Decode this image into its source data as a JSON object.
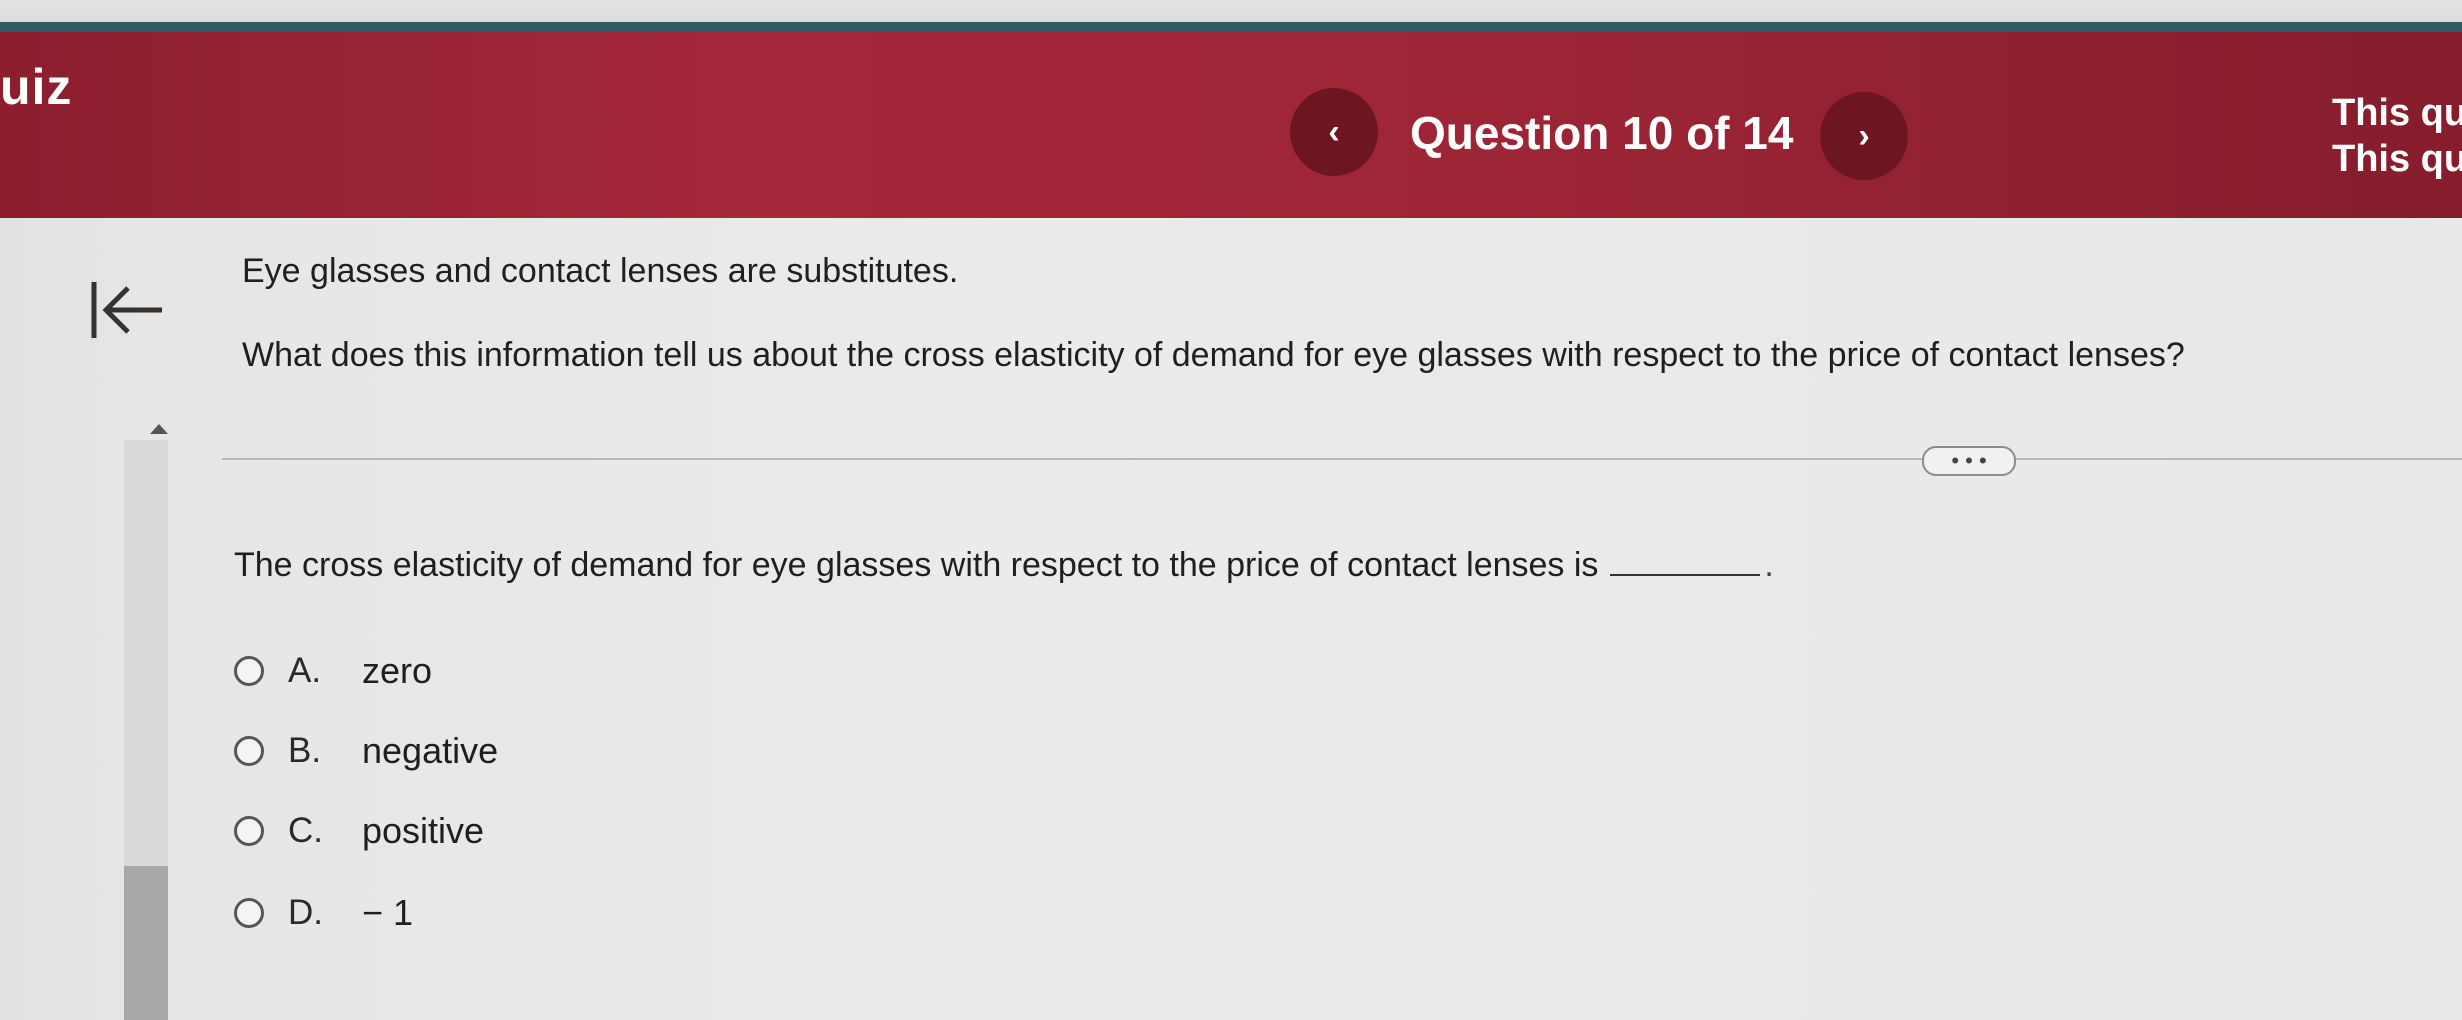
{
  "header": {
    "title": "uiz",
    "question_counter": "Question 10 of 14",
    "prev_glyph": "‹",
    "next_glyph": "›",
    "right_note_line1": "This qu",
    "right_note_line2": "This qu"
  },
  "question": {
    "line1": "Eye glasses and contact lenses are substitutes.",
    "line2": "What does this information tell us about the cross elasticity of demand for eye glasses with respect to the price of contact lenses?",
    "more_label": "• • •",
    "statement": "The cross elasticity of demand for eye glasses with respect to the price of contact lenses is",
    "statement_end": "."
  },
  "options": [
    {
      "letter": "A.",
      "text": "zero"
    },
    {
      "letter": "B.",
      "text": "negative"
    },
    {
      "letter": "C.",
      "text": "positive"
    },
    {
      "letter": "D.",
      "text": "− 1"
    }
  ],
  "colors": {
    "header_red": "#a3283a",
    "nav_circle": "#6e1522",
    "teal_line": "#2f5b63"
  },
  "icons": {
    "back": "arrow-left-to-line-icon",
    "prev": "chevron-left-icon",
    "next": "chevron-right-icon"
  }
}
